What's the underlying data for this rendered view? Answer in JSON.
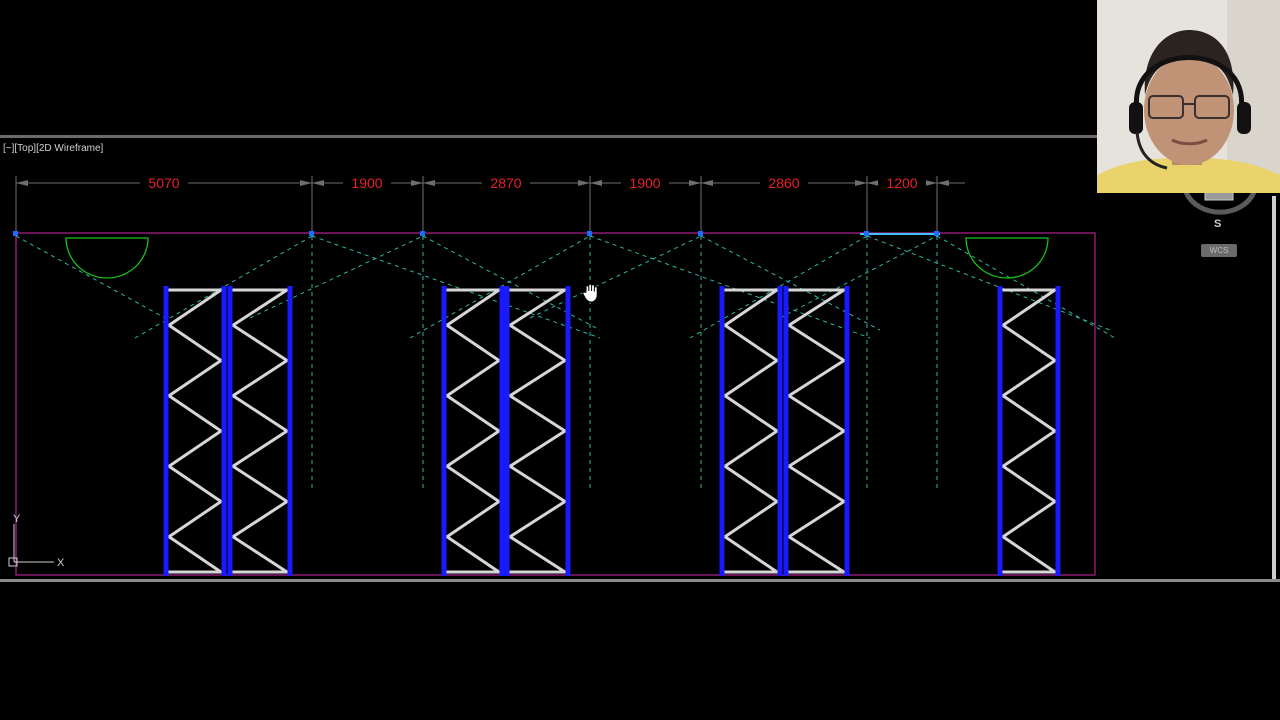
{
  "viewport": {
    "label": "[−][Top][2D Wireframe]"
  },
  "dimensions": [
    "5070",
    "1900",
    "2870",
    "1900",
    "2860",
    "1200"
  ],
  "viewcube": {
    "compass_south": "S",
    "coordinate_system": "WCS"
  },
  "ucs": {
    "x_label": "X",
    "y_label": "Y"
  },
  "colors": {
    "background": "#000000",
    "dimension_text": "#e8202a",
    "rack_upright": "#1a1aff",
    "rack_bracing": "#d6d6d6",
    "boundary": "#b0208f",
    "centerline": "#2fb5a0",
    "arc": "#18c018"
  }
}
